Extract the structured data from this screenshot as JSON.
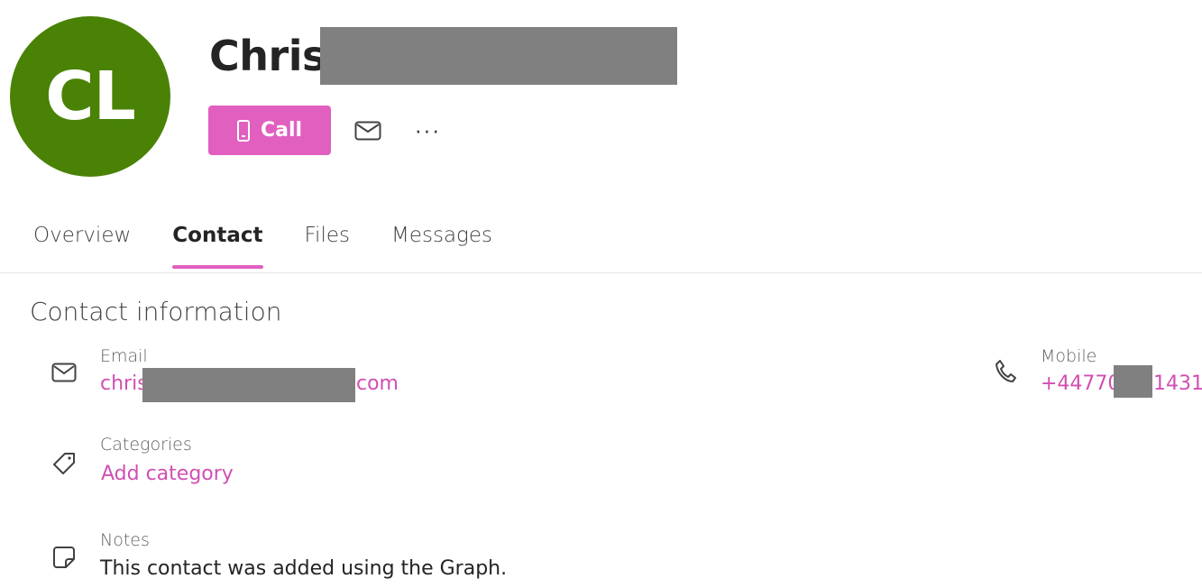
{
  "profile": {
    "initials": "CL",
    "avatar_color": "#498205",
    "first_name": "Chris"
  },
  "actions": {
    "call_label": "Call",
    "call_icon": "mobile-phone-icon",
    "email_icon": "mail-icon",
    "more_icon": "more-horizontal-icon",
    "more_glyph": "···",
    "accent_color": "#e15fbf"
  },
  "tabs": [
    {
      "label": "Overview",
      "active": false
    },
    {
      "label": "Contact",
      "active": true
    },
    {
      "label": "Files",
      "active": false
    },
    {
      "label": "Messages",
      "active": false
    }
  ],
  "contact": {
    "section_title": "Contact information",
    "email": {
      "icon": "mail-icon",
      "label": "Email",
      "value_prefix": "chris",
      "value_suffix": "com"
    },
    "mobile": {
      "icon": "phone-icon",
      "label": "Mobile",
      "value_prefix": "+44770",
      "value_suffix": "1431"
    },
    "categories": {
      "icon": "tag-icon",
      "label": "Categories",
      "action": "Add category"
    },
    "notes": {
      "icon": "note-icon",
      "label": "Notes",
      "value": "This contact was added using the Graph."
    }
  }
}
